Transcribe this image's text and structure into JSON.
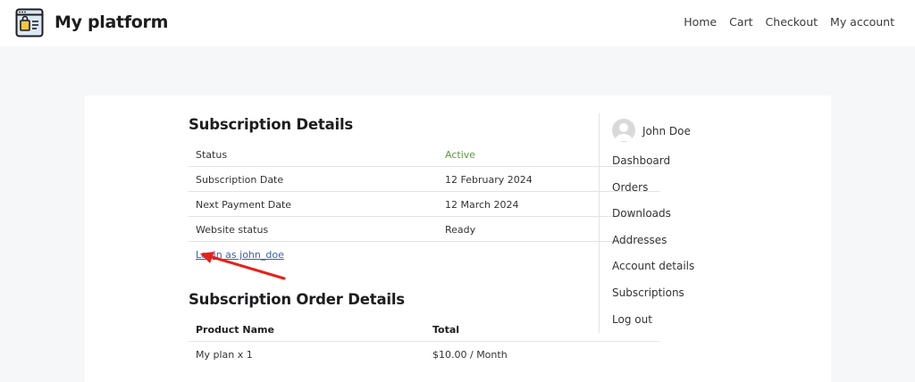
{
  "header": {
    "site_title": "My platform",
    "logo_icon": "shopping-bag-window-icon",
    "nav": [
      "Home",
      "Cart",
      "Checkout",
      "My account"
    ]
  },
  "subscription": {
    "title": "Subscription Details",
    "rows": [
      {
        "label": "Status",
        "value": "Active"
      },
      {
        "label": "Subscription Date",
        "value": "12 February 2024"
      },
      {
        "label": "Next Payment Date",
        "value": "12 March 2024"
      },
      {
        "label": "Website status",
        "value": "Ready"
      }
    ],
    "login_link": "Login as john_doe",
    "status_color": "#5b9b3d"
  },
  "order": {
    "title": "Subscription Order Details",
    "headers": [
      "Product Name",
      "Total"
    ],
    "rows": [
      {
        "product": "My plan x 1",
        "total": "$10.00 / Month"
      }
    ]
  },
  "account": {
    "user_name": "John Doe",
    "avatar_icon": "user-avatar-icon",
    "menu": [
      "Dashboard",
      "Orders",
      "Downloads",
      "Addresses",
      "Account details",
      "Subscriptions",
      "Log out"
    ]
  },
  "annotation": {
    "arrow_color": "#e8201a"
  }
}
